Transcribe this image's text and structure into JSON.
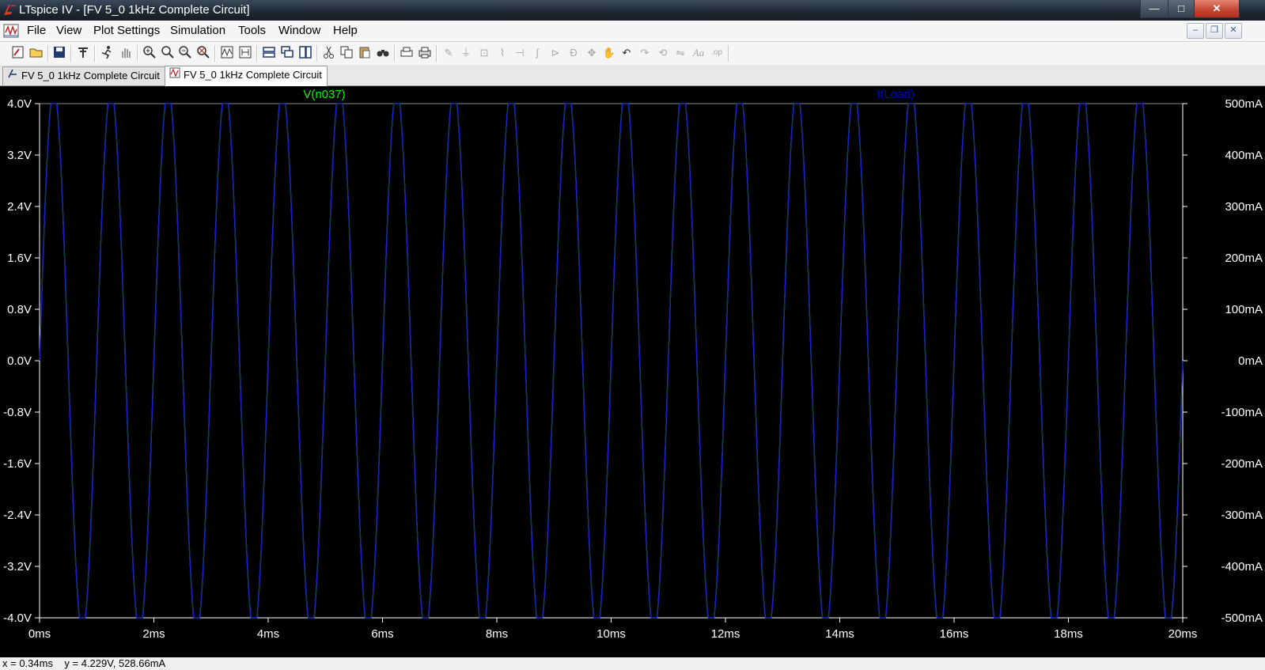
{
  "window": {
    "title": "LTspice IV - [FV 5_0 1kHz Complete Circuit]",
    "buttons": {
      "minimize": "—",
      "maximize": "□",
      "close": "✕"
    }
  },
  "menu": {
    "items": [
      {
        "label": "File"
      },
      {
        "label": "View"
      },
      {
        "label": "Plot Settings"
      },
      {
        "label": "Simulation"
      },
      {
        "label": "Tools"
      },
      {
        "label": "Window"
      },
      {
        "label": "Help"
      }
    ],
    "mdi_buttons": {
      "minimize": "–",
      "restore": "❐",
      "close": "✕"
    }
  },
  "toolbar": {
    "icons": [
      "new-schematic-icon",
      "open-folder-icon",
      "save-icon",
      "control-panel-icon",
      "run-icon",
      "pan-hand-icon",
      "zoom-in-icon",
      "zoom-area-icon",
      "zoom-out-icon",
      "zoom-fit-icon",
      "autorange-icon",
      "mark-plot-icon",
      "tile-horizontal-icon",
      "cascade-icon",
      "tile-vertical-icon",
      "cut-icon",
      "copy-icon",
      "paste-icon",
      "find-icon",
      "print-preview-icon",
      "print-icon",
      "wire-icon",
      "ground-icon",
      "label-net-icon",
      "resistor-icon",
      "capacitor-icon",
      "inductor-icon",
      "diode-icon",
      "component-icon",
      "move-icon",
      "drag-icon",
      "undo-icon",
      "redo-icon",
      "rotate-icon",
      "mirror-icon",
      "text-icon",
      "spice-directive-icon"
    ]
  },
  "tabs": [
    {
      "label": "FV 5_0 1kHz Complete Circuit",
      "icon": "schematic-icon",
      "active": false
    },
    {
      "label": "FV 5_0 1kHz Complete Circuit",
      "icon": "waveform-icon",
      "active": true
    }
  ],
  "plot": {
    "background": "#000000",
    "axis_color": "#ffffff",
    "trace_labels": [
      {
        "text": "V(n037)",
        "color": "#00ff00"
      },
      {
        "text": "I(Load)",
        "color": "#0000cc"
      }
    ]
  },
  "chart_data": {
    "type": "line",
    "title": "",
    "xlabel": "",
    "ylabel": "",
    "xlim": [
      0,
      20
    ],
    "ylim_left": [
      -4.0,
      4.0
    ],
    "ylim_right": [
      -500,
      500
    ],
    "x_tick_labels": [
      "0ms",
      "2ms",
      "4ms",
      "6ms",
      "8ms",
      "10ms",
      "12ms",
      "14ms",
      "16ms",
      "18ms",
      "20ms"
    ],
    "x_ticks": [
      0,
      2,
      4,
      6,
      8,
      10,
      12,
      14,
      16,
      18,
      20
    ],
    "y_left_tick_labels": [
      "4.0V",
      "3.2V",
      "2.4V",
      "1.6V",
      "0.8V",
      "0.0V",
      "-0.8V",
      "-1.6V",
      "-2.4V",
      "-3.2V",
      "-4.0V"
    ],
    "y_left_ticks": [
      4.0,
      3.2,
      2.4,
      1.6,
      0.8,
      0.0,
      -0.8,
      -1.6,
      -2.4,
      -3.2,
      -4.0
    ],
    "y_right_tick_labels": [
      "500mA",
      "400mA",
      "300mA",
      "200mA",
      "100mA",
      "0mA",
      "-100mA",
      "-200mA",
      "-300mA",
      "-400mA",
      "-500mA"
    ],
    "y_right_ticks": [
      500,
      400,
      300,
      200,
      100,
      0,
      -100,
      -200,
      -300,
      -400,
      -500
    ],
    "series": [
      {
        "name": "V(n037)",
        "color": "#00ff00",
        "axis": "left",
        "shape": "sine",
        "amplitude": 4.229,
        "frequency_khz": 1,
        "start_ms": 0,
        "end_ms": 20
      },
      {
        "name": "I(Load)",
        "color": "#1a1acc",
        "axis": "right",
        "shape": "sine",
        "amplitude": 528.66,
        "frequency_khz": 1,
        "start_ms": 0,
        "end_ms": 20
      }
    ]
  },
  "status": {
    "text": "x = 0.34ms    y = 4.229V, 528.66mA"
  }
}
